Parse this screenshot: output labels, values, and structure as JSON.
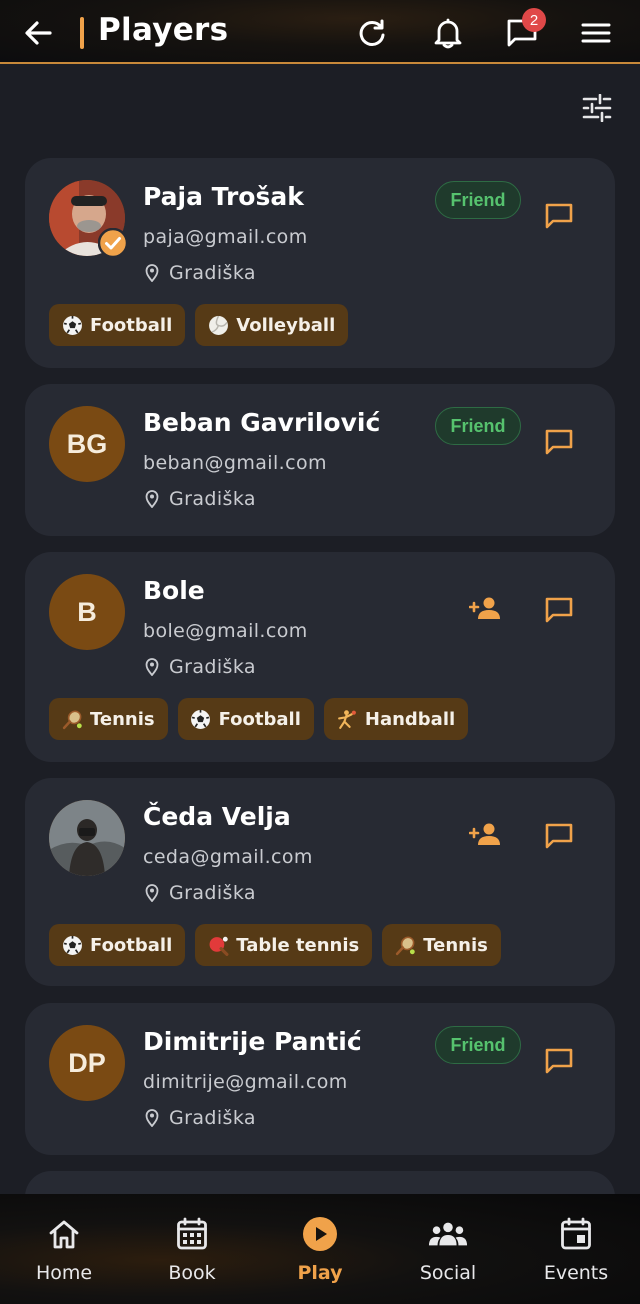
{
  "header": {
    "title": "Players",
    "message_badge": "2"
  },
  "colors": {
    "accent": "#f0a24a",
    "friend_text": "#56c26e",
    "tag_bg": "#563a16",
    "card_bg": "#272a33",
    "avatar_bg": "#7a4a13"
  },
  "players": [
    {
      "name": "Paja Trošak",
      "email": "paja@gmail.com",
      "location": "Gradiška",
      "avatar": "photo",
      "verified": true,
      "friend_label": "Friend",
      "tags": [
        {
          "icon": "soccer-ball",
          "label": "Football"
        },
        {
          "icon": "volleyball",
          "label": "Volleyball"
        }
      ]
    },
    {
      "name": "Beban Gavrilović",
      "email": "beban@gmail.com",
      "location": "Gradiška",
      "initials": "BG",
      "friend_label": "Friend",
      "tags": []
    },
    {
      "name": "Bole",
      "email": "bole@gmail.com",
      "location": "Gradiška",
      "initials": "B",
      "action": "add-friend",
      "tags": [
        {
          "icon": "tennis-racket",
          "label": "Tennis"
        },
        {
          "icon": "soccer-ball",
          "label": "Football"
        },
        {
          "icon": "handball",
          "label": "Handball"
        }
      ]
    },
    {
      "name": "Čeda Velja",
      "email": "ceda@gmail.com",
      "location": "Gradiška",
      "avatar": "photo",
      "action": "add-friend",
      "tags": [
        {
          "icon": "soccer-ball",
          "label": "Football"
        },
        {
          "icon": "ping-pong",
          "label": "Table tennis"
        },
        {
          "icon": "tennis-racket",
          "label": "Tennis"
        }
      ]
    },
    {
      "name": "Dimitrije Pantić",
      "email": "dimitrije@gmail.com",
      "location": "Gradiška",
      "initials": "DP",
      "friend_label": "Friend",
      "tags": []
    }
  ],
  "nav": [
    {
      "label": "Home",
      "icon": "home-icon"
    },
    {
      "label": "Book",
      "icon": "calendar-grid-icon"
    },
    {
      "label": "Play",
      "icon": "play-circle-icon",
      "active": true
    },
    {
      "label": "Social",
      "icon": "people-icon"
    },
    {
      "label": "Events",
      "icon": "event-calendar-icon"
    }
  ]
}
